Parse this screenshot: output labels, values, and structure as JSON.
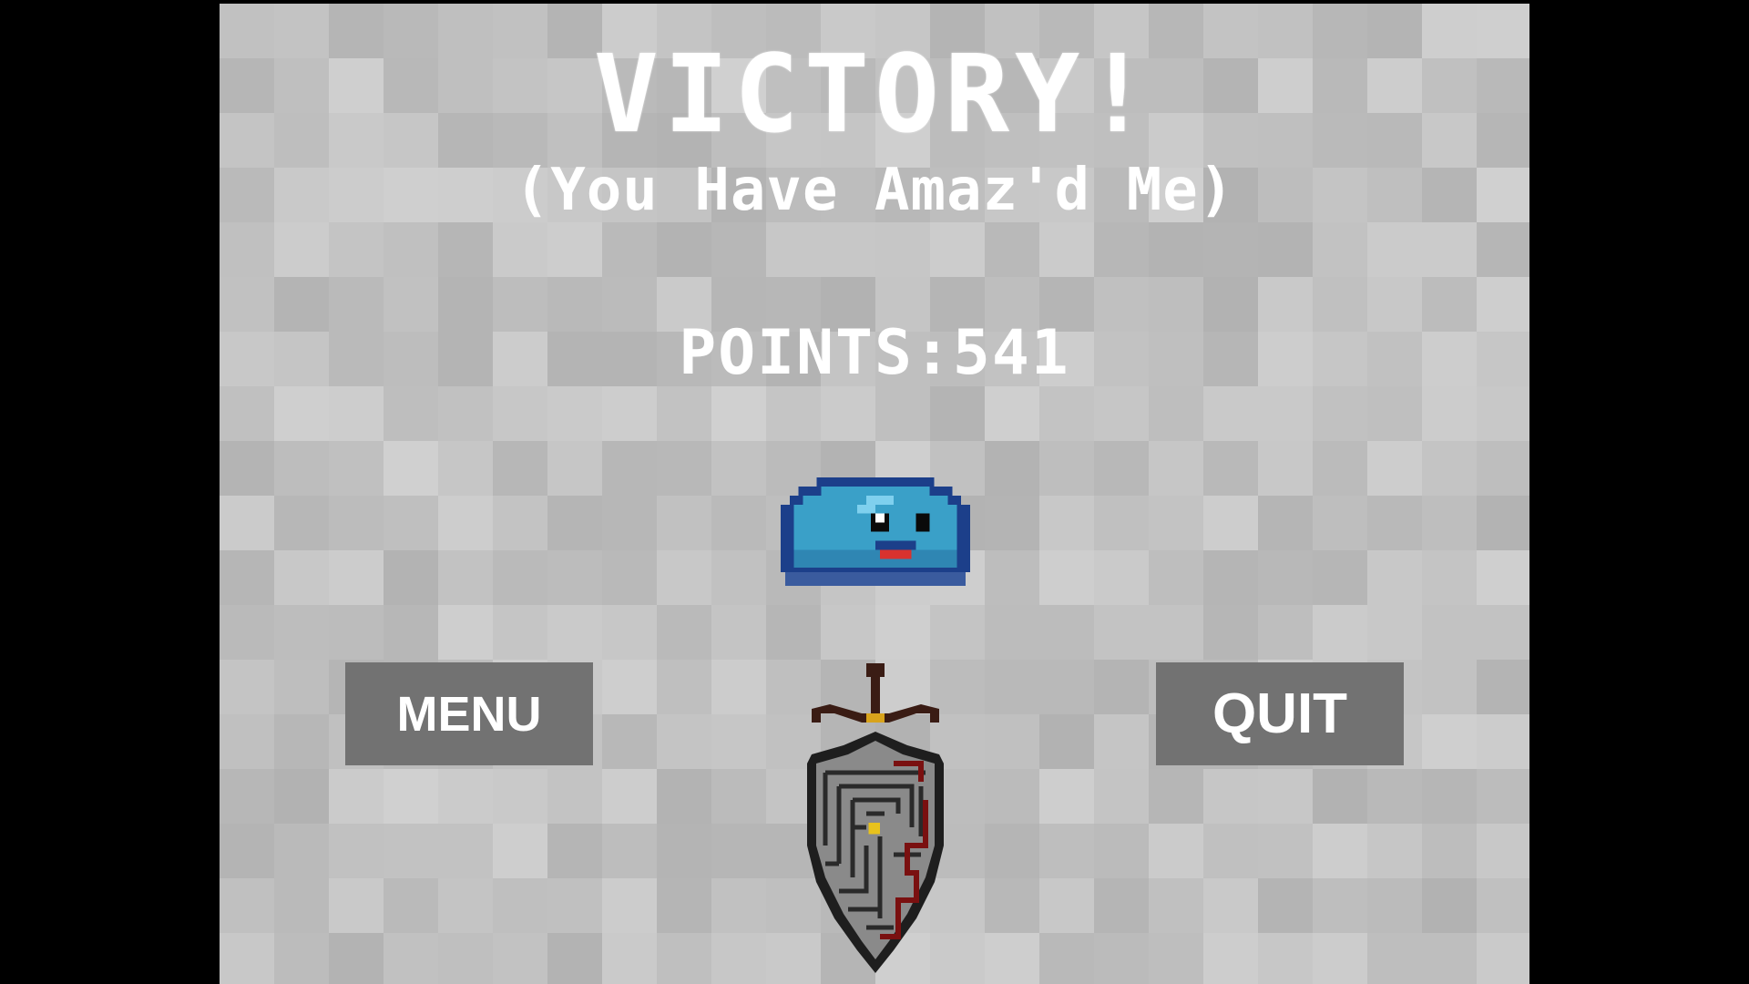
{
  "screen": {
    "title": "VICTORY!",
    "subtitle": "(You Have Amaz'd Me)",
    "points_text": "POINTS:541"
  },
  "buttons": {
    "menu_label": "MENU",
    "quit_label": "QUIT"
  },
  "icons": {
    "slime": "blue-slime-icon",
    "shield": "maze-shield-sword-icon"
  },
  "colors": {
    "background": "#bdbdbd",
    "button": "#727272",
    "text": "#ffffff",
    "slime": "#3aa0c8",
    "slime_outline": "#1c3f8a",
    "shield": "#8a8a8a"
  }
}
